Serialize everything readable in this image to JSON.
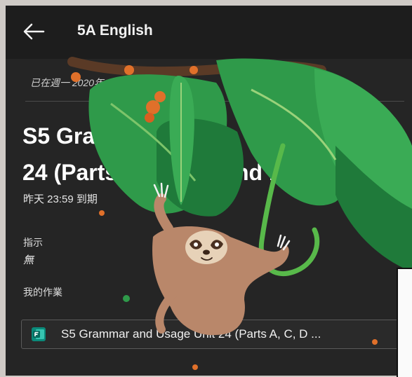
{
  "header": {
    "back_icon": "arrow-left-icon",
    "title": "5A English"
  },
  "assignment": {
    "posted": "已在週一 2020年",
    "title_line1": "S5 Gram",
    "title_line2": "24 (Parts",
    "title_line2b": "nd F",
    "due": "昨天 23:59 到期",
    "instructions_label": "指示",
    "instructions_value": "無",
    "my_work_label": "我的作業",
    "attachment": {
      "icon": "microsoft-forms-icon",
      "name": "S5 Grammar and Usage Unit 24 (Parts A, C, D ..."
    }
  },
  "illustration": {
    "subject": "sloth-hanging-from-vine",
    "colors": {
      "leaf": "#2f9a4a",
      "leaf_dark": "#1f7a3a",
      "vine": "#58b94a",
      "sloth": "#b9876a",
      "flower": "#e0702a"
    }
  }
}
